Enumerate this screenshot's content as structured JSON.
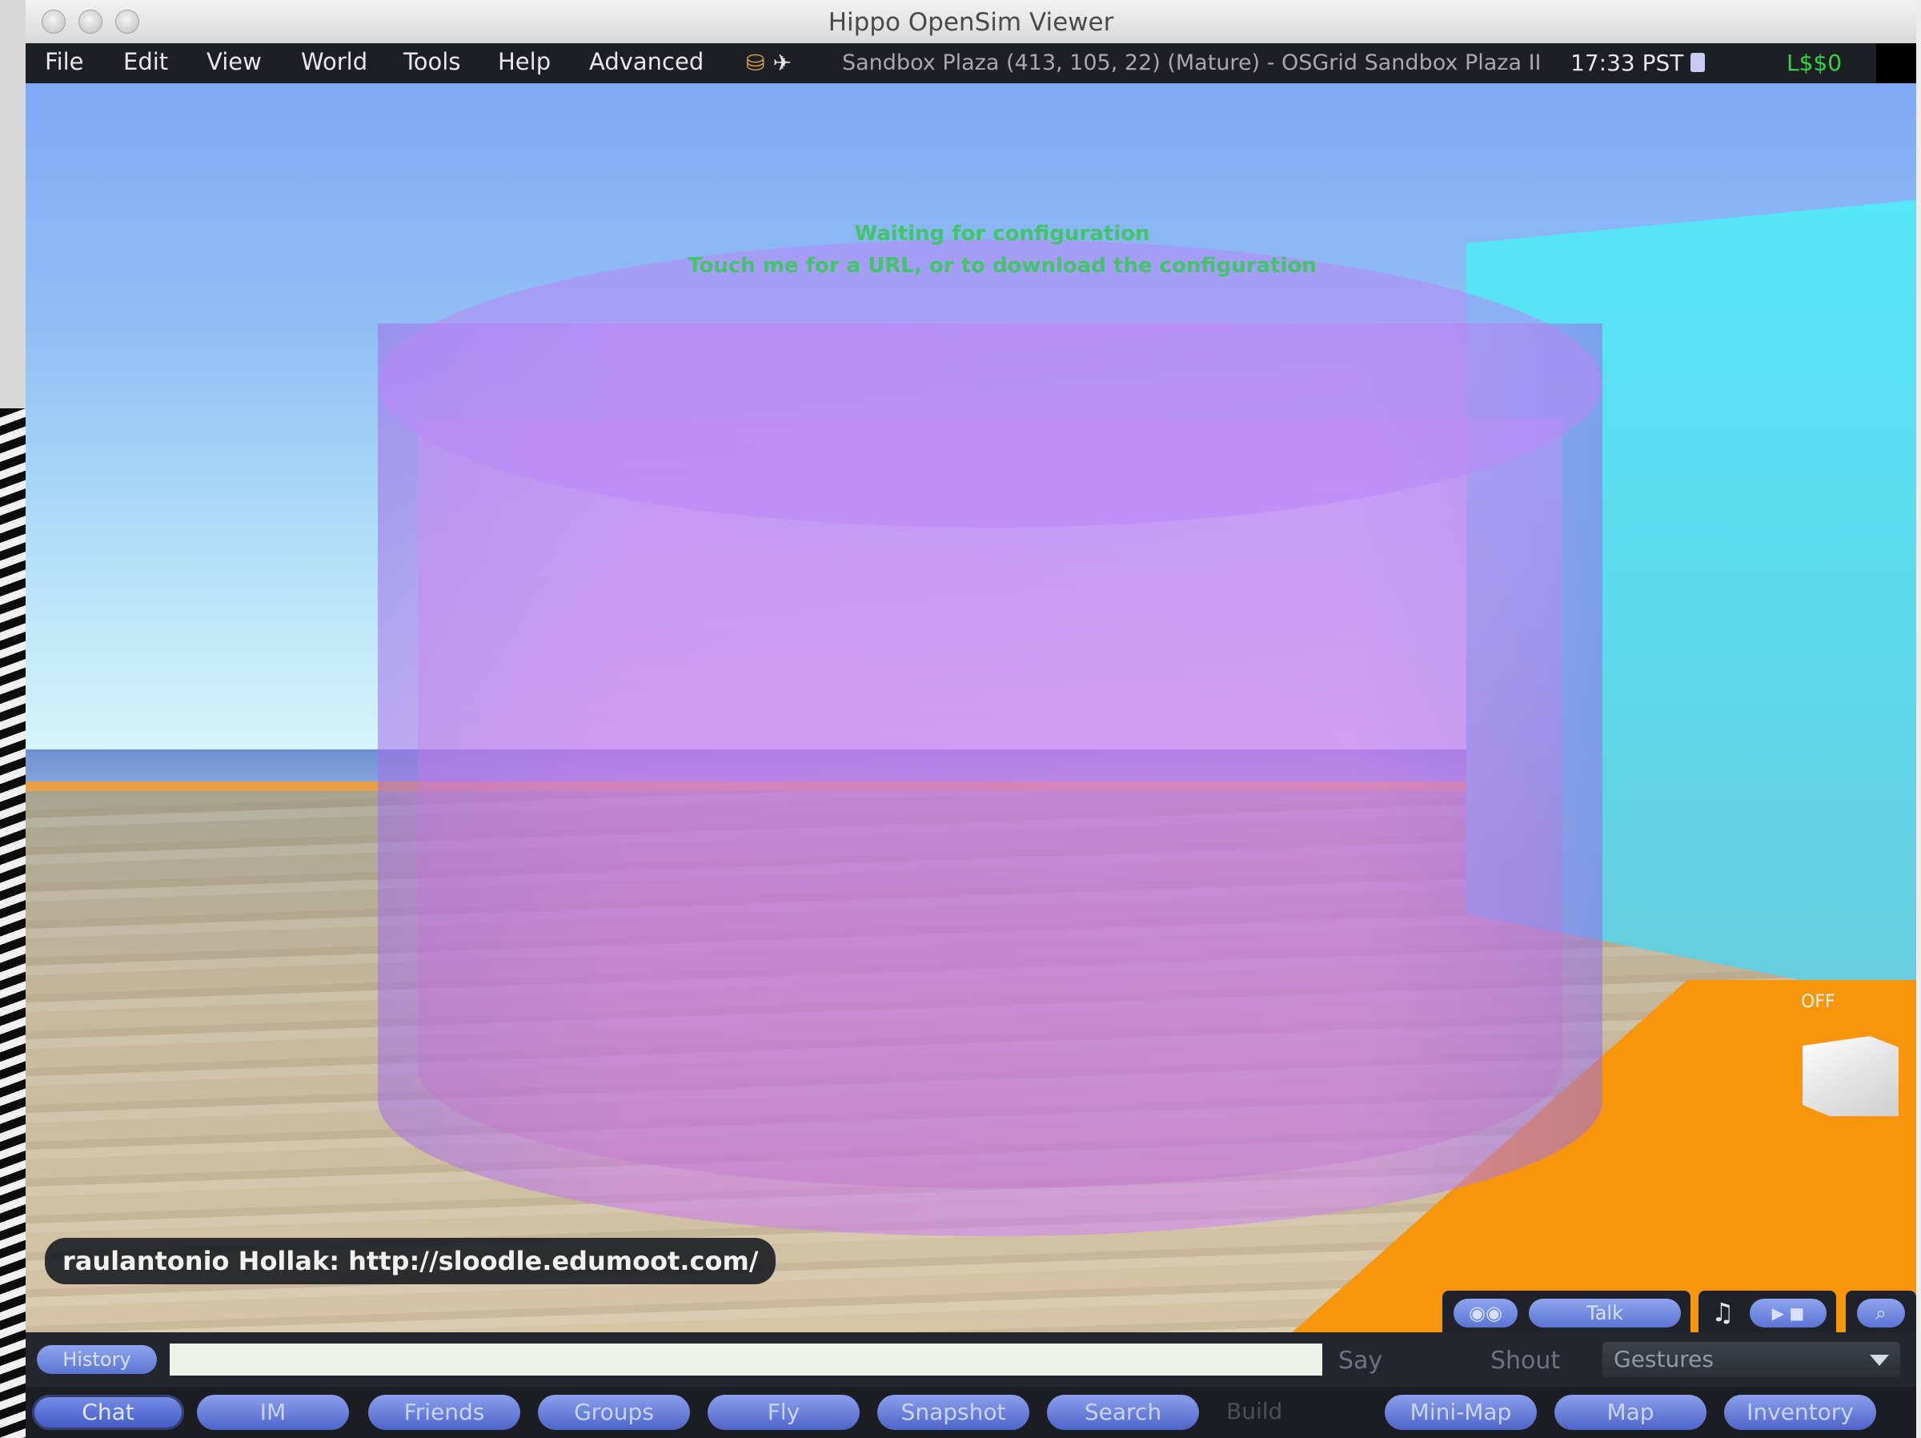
{
  "window": {
    "title": "Hippo OpenSim Viewer"
  },
  "menu": {
    "items": [
      "File",
      "Edit",
      "View",
      "World",
      "Tools",
      "Help",
      "Advanced"
    ],
    "location": "Sandbox Plaza (413, 105, 22) (Mature) - OSGrid Sandbox Plaza II",
    "clock": "17:33 PST",
    "balance": "L$$0"
  },
  "scene": {
    "hover_text_1": "Waiting for configuration",
    "hover_text_2": "Touch me for a URL, or to download the configuration",
    "box_label": "OFF",
    "chat_line": "raulantonio Hollak: http://sloodle.edumoot.com/"
  },
  "overlay": {
    "talk_label": "Talk",
    "music_icon": "♫",
    "media_label": "▶ ■"
  },
  "chatbar": {
    "history_label": "History",
    "input_value": "",
    "say_label": "Say",
    "shout_label": "Shout",
    "gestures_label": "Gestures"
  },
  "toolbar": {
    "chat": "Chat",
    "im": "IM",
    "friends": "Friends",
    "groups": "Groups",
    "fly": "Fly",
    "snapshot": "Snapshot",
    "search": "Search",
    "build": "Build",
    "minimap": "Mini-Map",
    "map": "Map",
    "inventory": "Inventory"
  },
  "colors": {
    "accent_button": "#5c74d3",
    "balance_green": "#34d34a",
    "hover_text_green": "#41c46a",
    "cylinder_purple": "#c080f0"
  }
}
